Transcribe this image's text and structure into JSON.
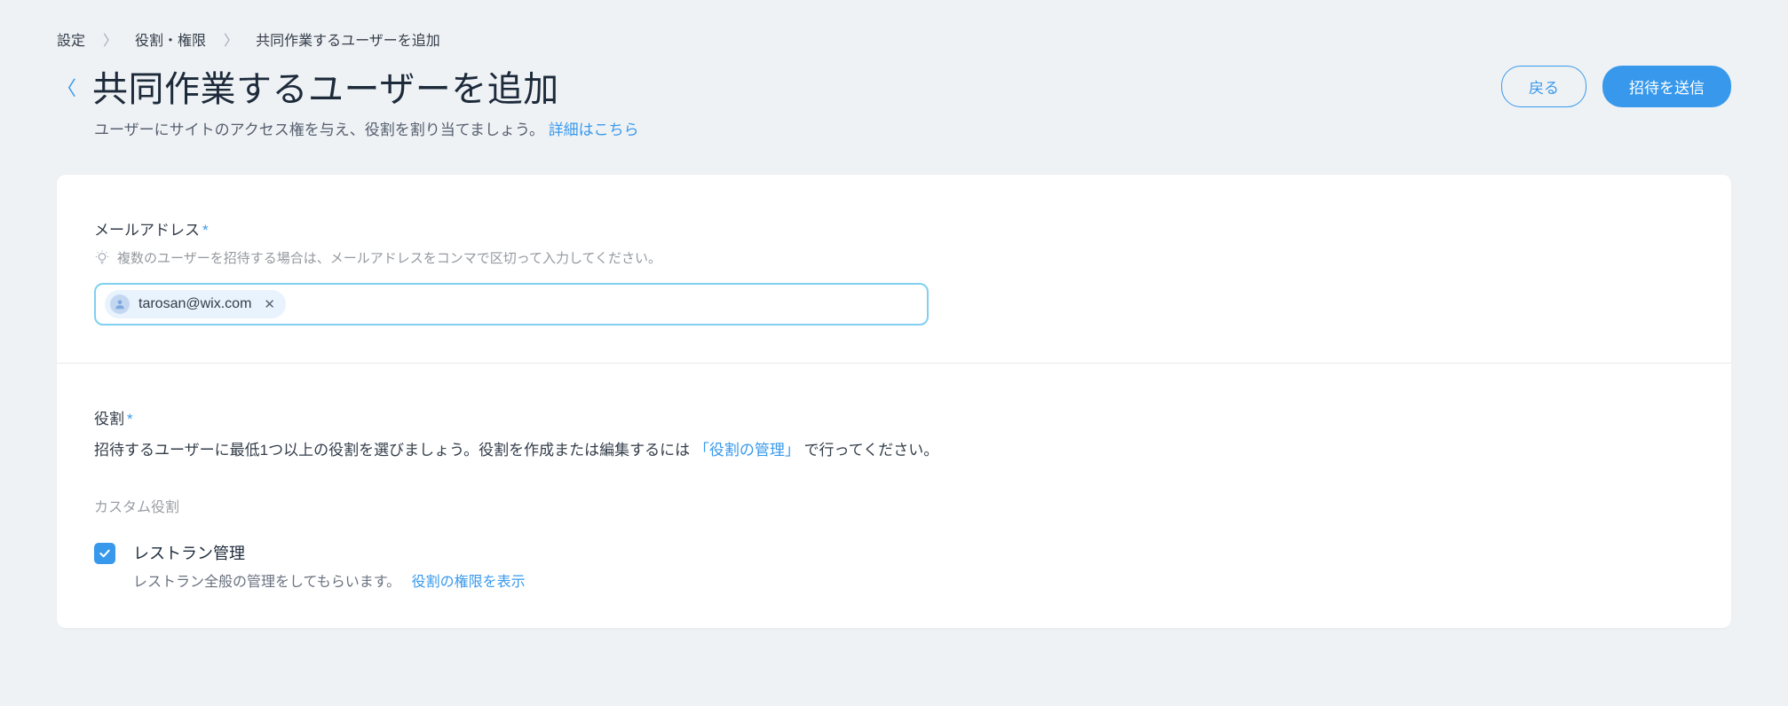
{
  "breadcrumb": {
    "items": [
      "設定",
      "役割・権限",
      "共同作業するユーザーを追加"
    ]
  },
  "header": {
    "title": "共同作業するユーザーを追加",
    "subtitle": "ユーザーにサイトのアクセス権を与え、役割を割り当てましょう。",
    "subtitle_link": "詳細はこちら",
    "back_button": "戻る",
    "submit_button": "招待を送信"
  },
  "email_section": {
    "label": "メールアドレス",
    "helper": "複数のユーザーを招待する場合は、メールアドレスをコンマで区切って入力してください。",
    "chips": [
      {
        "email": "tarosan@wix.com"
      }
    ]
  },
  "role_section": {
    "label": "役割",
    "description_prefix": "招待するユーザーに最低1つ以上の役割を選びましょう。役割を作成または編集するには",
    "description_link": "「役割の管理」",
    "description_suffix": "で行ってください。",
    "custom_label": "カスタム役割",
    "roles": [
      {
        "title": "レストラン管理",
        "description": "レストラン全般の管理をしてもらいます。",
        "permissions_link": "役割の権限を表示",
        "checked": true
      }
    ]
  }
}
